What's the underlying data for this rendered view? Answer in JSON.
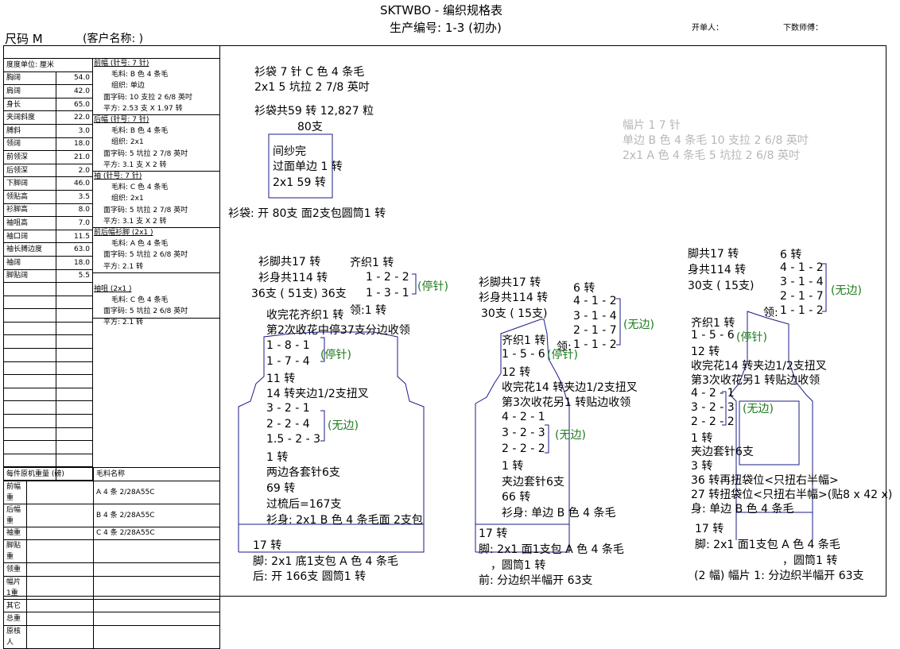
{
  "header": {
    "title": "SKTWBO - 编织规格表",
    "production_no": "生产编号: 1-3 (初办)",
    "order_by": "开单人：",
    "instructor": "下数师傅：",
    "size": "尺码  M",
    "customer": "(客户名称: )"
  },
  "measure_table": {
    "header": "度度单位: 厘米",
    "rows": [
      [
        "胸阔",
        "54.0"
      ],
      [
        "肩阔",
        "42.0"
      ],
      [
        "身长",
        "65.0"
      ],
      [
        "夹阔斜度",
        "22.0"
      ],
      [
        "膊斜",
        "3.0"
      ],
      [
        "领阔",
        "18.0"
      ],
      [
        "前领深",
        "21.0"
      ],
      [
        "后领深",
        "2.0"
      ],
      [
        "下脚阔",
        "46.0"
      ],
      [
        "领贴高",
        "3.5"
      ],
      [
        "衫脚高",
        "8.0"
      ],
      [
        "袖咀高",
        "7.0"
      ],
      [
        "袖口阔",
        "11.5"
      ],
      [
        "袖长膊边度",
        "63.0"
      ],
      [
        "袖阔",
        "18.0"
      ],
      [
        "脚贴阔",
        "5.5"
      ],
      [
        "",
        ""
      ],
      [
        "",
        ""
      ],
      [
        "",
        ""
      ],
      [
        "",
        ""
      ],
      [
        "",
        ""
      ],
      [
        "",
        ""
      ],
      [
        "",
        ""
      ],
      [
        "",
        ""
      ],
      [
        "",
        ""
      ],
      [
        "",
        ""
      ],
      [
        "",
        ""
      ],
      [
        "",
        ""
      ],
      [
        "",
        ""
      ],
      [
        "",
        ""
      ],
      [
        "",
        ""
      ]
    ]
  },
  "spec_blocks": [
    {
      "title": "前幅 (针号: 7 针)",
      "lines": [
        "毛料: B 色 4 条毛",
        "组织: 单边",
        "面字码: 10 支拉 2 6/8 英吋",
        "平方: 2.53 支 X 1.97 转"
      ]
    },
    {
      "title": "后幅 (针号: 7 针)",
      "lines": [
        "毛料: B 色 4 条毛",
        "组织: 2x1",
        "面字码: 5 坑拉 2 7/8 英吋",
        "平方: 3.1 支 X 2 转"
      ]
    },
    {
      "title": "袖 (针号: 7 针)",
      "lines": [
        "毛料: C 色 4 条毛",
        "组织: 2x1",
        "面字码: 5 坑拉 2 7/8 英吋",
        "平方: 3.1 支 X 2 转"
      ]
    },
    {
      "title": "前后幅衫脚 (2x1 )",
      "lines": [
        "毛料: A 色 4 条毛",
        "面字码: 5 坑拉 2 6/8 英吋",
        "平方: 2.1 转"
      ]
    },
    {
      "title": "袖咀 (2x1 )",
      "lines": [
        "毛料: C 色 4 条毛",
        "面字码: 5 坑拉 2 6/8 英吋",
        "平方: 2.1 转"
      ]
    }
  ],
  "weight_table": {
    "header": [
      "每件原机重量 (磅)",
      "毛料名称"
    ],
    "rows": [
      [
        "前幅重",
        "A  4 条 2/28A55C"
      ],
      [
        "后幅重",
        "B  4 条 2/28A55C"
      ],
      [
        "袖重",
        "C  4 条 2/28A55C"
      ],
      [
        "脚贴重",
        ""
      ],
      [
        "领重",
        ""
      ],
      [
        "幅片 1重",
        ""
      ],
      [
        "其它",
        ""
      ],
      [
        "总重",
        ""
      ],
      [
        "原核人",
        ""
      ]
    ]
  },
  "cuff": {
    "l1": "衫袋  7 针 C 色 4 条毛",
    "l2": "2x1   5 坑拉 2 7/8 英吋",
    "l3": "衫袋共59 转 12,827 粒",
    "l4": "80支",
    "in1": "间纱完",
    "in2": "过面单边 1 转",
    "in3": "2x1        59 转",
    "bottom": "衫袋: 开 80支 面2支包圆筒1 转"
  },
  "piece_note": {
    "l1": "幅片 1  7 针",
    "l2": "单边  B 色 4 条毛 10 支拉 2 6/8 英吋",
    "l3": "2x1    A 色 4 条毛 5 坑拉 2 6/8 英吋"
  },
  "back": {
    "a1": "衫脚共17 转",
    "a2": "衫身共114 转",
    "a3": "36支 ( 51支) 36支",
    "b1": "齐织1 转",
    "b2": "1 - 2 - 2",
    "b3": "1 - 3 - 1",
    "stop": "(停针)",
    "neck": "领:1 转",
    "c1": "收完花齐织1 转",
    "c2": "第2次收花中停37支分边收领",
    "d1": "1 - 8 - 1",
    "d2": "1 - 7 - 4",
    "d3": "11 转",
    "d4": "14 转夹边1/2支扭叉",
    "e1": "3 - 2 - 1",
    "e2": "2 - 2 - 4",
    "e3": "1.5 - 2 - 3",
    "none": "(无边)",
    "f1": "1 转",
    "f2": "两边各套针6支",
    "f3": "69 转",
    "f4": "过梳后=167支",
    "f5": "衫身: 2x1   B 色 4 条毛面 2支包",
    "g1": "17 转",
    "g2": "脚: 2x1   底1支包 A 色 4 条毛",
    "g3": "后: 开 166支 圆筒1 转"
  },
  "front": {
    "a1": "衫脚共17 转",
    "a2": "衫身共114 转",
    "a3": "30支 ( 15支)",
    "n1": "6 转",
    "n2": "4 - 1 - 2",
    "n3": "3 - 1 - 4",
    "n4": "2 - 1 - 7",
    "n5": "1 - 1 - 2",
    "neck": "领:",
    "none": "(无边)",
    "b1": "齐织1 转",
    "b2": "1 - 5 - 6",
    "stop": "(停针)",
    "b3": "12 转",
    "b4": "收完花14 转夹边1/2支扭叉",
    "b5": "第3次收花另1 转贴边收领",
    "c1": "4 - 2 - 1",
    "c2": "3 - 2 - 3",
    "c3": "2 - 2 - 2",
    "c4": "1 转",
    "c5": "夹边套针6支",
    "c6": "66 转",
    "c7": "衫身: 单边 B 色 4 条毛",
    "d1": "17 转",
    "d2": "脚: 2x1   面1支包 A 色 4 条毛",
    "d3": "，圆筒1 转",
    "d4": "前: 分边织半幅开 63支"
  },
  "piece": {
    "a1": "脚共17 转",
    "a2": "身共114 转",
    "a3": "30支 ( 15支)",
    "n1": "6 转",
    "n2": "4 - 1 - 2",
    "n3": "3 - 1 - 4",
    "n4": "2 - 1 - 7",
    "n5": "1 - 1 - 2",
    "neck": "领:",
    "none": "(无边)",
    "b1": "齐织1 转",
    "b2": "1 - 5 - 6",
    "stop": "(停针)",
    "b3": "12 转",
    "b4": "收完花14 转夹边1/2支扭叉",
    "b5": "第3次收花另1 转贴边收领",
    "c1": "4 - 2 - 1",
    "c2": "3 - 2 - 3",
    "c3": "2 - 2 - 2",
    "c4": "1 转",
    "c5": "夹边套针6支",
    "c6": "3 转",
    "c7": "36 转再扭袋位<只扭右半幅>",
    "c8": "27 转扭袋位<只扭右半幅>(贴8 x 42 x)",
    "c9": "身: 单边 B 色 4 条毛",
    "d1": "17 转",
    "d2": "脚: 2x1   面1支包 A 色 4 条毛",
    "d3": "，圆筒1 转",
    "d4": "(2 幅) 幅片 1: 分边织半幅开 63支"
  }
}
